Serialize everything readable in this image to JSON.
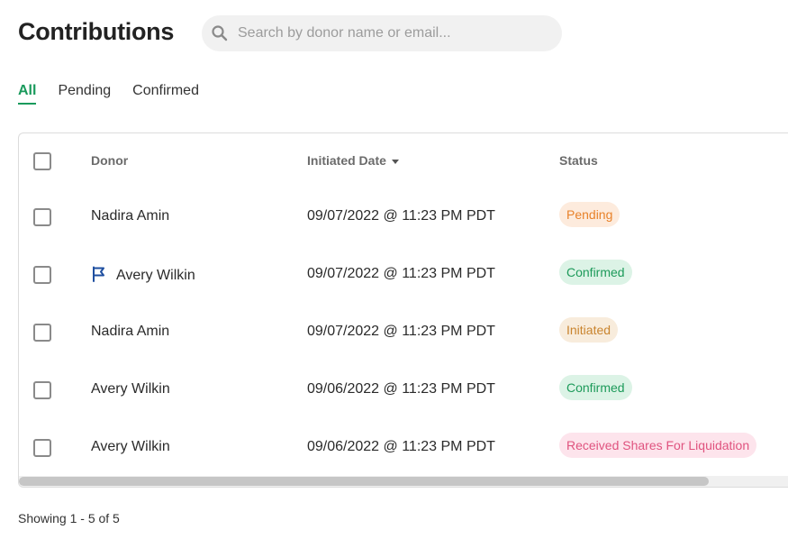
{
  "header": {
    "title": "Contributions",
    "search": {
      "placeholder": "Search by donor name or email...",
      "value": ""
    }
  },
  "tabs": [
    {
      "label": "All",
      "active": true
    },
    {
      "label": "Pending",
      "active": false
    },
    {
      "label": "Confirmed",
      "active": false
    }
  ],
  "table": {
    "columns": {
      "donor": "Donor",
      "initiated_date": "Initiated Date",
      "status": "Status"
    },
    "sort": {
      "column": "initiated_date",
      "direction": "desc"
    },
    "rows": [
      {
        "donor": "Nadira Amin",
        "flagged": false,
        "date": "09/07/2022 @ 11:23 PM PDT",
        "status": "Pending",
        "status_kind": "pending"
      },
      {
        "donor": "Avery Wilkin",
        "flagged": true,
        "date": "09/07/2022 @ 11:23 PM PDT",
        "status": "Confirmed",
        "status_kind": "confirmed"
      },
      {
        "donor": "Nadira Amin",
        "flagged": false,
        "date": "09/07/2022 @ 11:23 PM PDT",
        "status": "Initiated",
        "status_kind": "initiated"
      },
      {
        "donor": "Avery Wilkin",
        "flagged": false,
        "date": "09/06/2022 @ 11:23 PM PDT",
        "status": "Confirmed",
        "status_kind": "confirmed"
      },
      {
        "donor": "Avery Wilkin",
        "flagged": false,
        "date": "09/06/2022 @ 11:23 PM PDT",
        "status": "Received Shares For Liquidation",
        "status_kind": "received"
      }
    ]
  },
  "footer": {
    "showing": "Showing 1 - 5 of 5"
  },
  "colors": {
    "accent": "#1a9a5c",
    "pending": "#e8822a",
    "confirmed": "#1d9a5a",
    "initiated": "#c9842e",
    "received": "#e0537f",
    "flag": "#1f4fa0"
  },
  "icons": {
    "search": "search-icon",
    "flag": "flag-icon",
    "sort": "sort-caret-down-icon"
  }
}
